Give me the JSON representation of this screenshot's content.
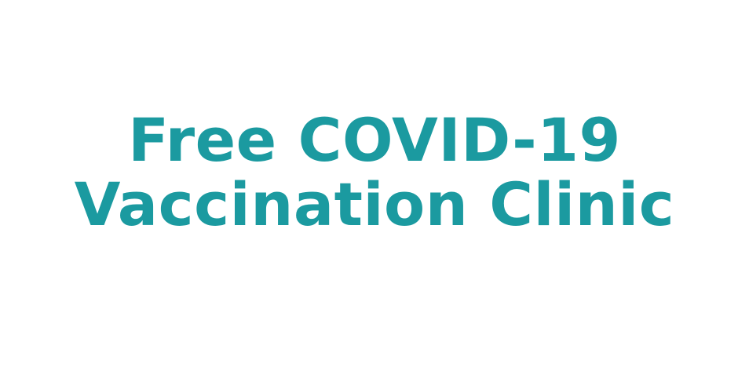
{
  "headline": {
    "line1": "Free COVID-19",
    "line2": "Vaccination Clinic"
  },
  "colors": {
    "background": "#ffffff",
    "text": "#1b9aa0"
  }
}
